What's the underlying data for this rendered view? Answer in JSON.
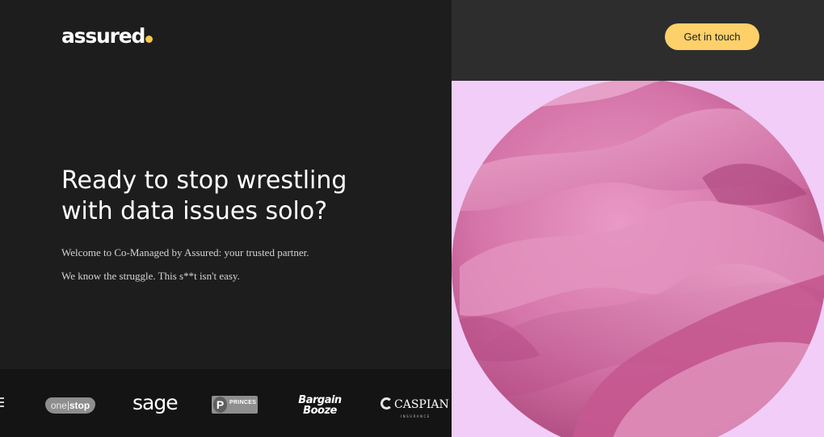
{
  "brand": {
    "name": "assured",
    "accent": "#f7c948"
  },
  "header": {
    "cta_label": "Get in touch",
    "cta_color": "#fdd069"
  },
  "hero": {
    "headline": "Ready to stop wrestling with data issues solo?",
    "paragraphs": [
      "Welcome to Co-Managed by Assured: your trusted partner.",
      "We know the struggle. This s**t isn't easy."
    ]
  },
  "client_logos": {
    "one_stop": {
      "one": "one",
      "stop": "stop"
    },
    "sage": "sage",
    "princes": {
      "mark": "P",
      "text": "PRINCES"
    },
    "bargain_booze": {
      "line1": "Bargain",
      "line2": "Booze"
    },
    "caspian": {
      "name": "CASPIAN",
      "sub": "INSURANCE"
    }
  },
  "colors": {
    "left_bg": "#1d1d1d",
    "logo_strip_bg": "#141414",
    "topbar_bg": "#2e2d2e",
    "art_bg": "#f1cdf7",
    "art_pink": "#d776a8"
  }
}
